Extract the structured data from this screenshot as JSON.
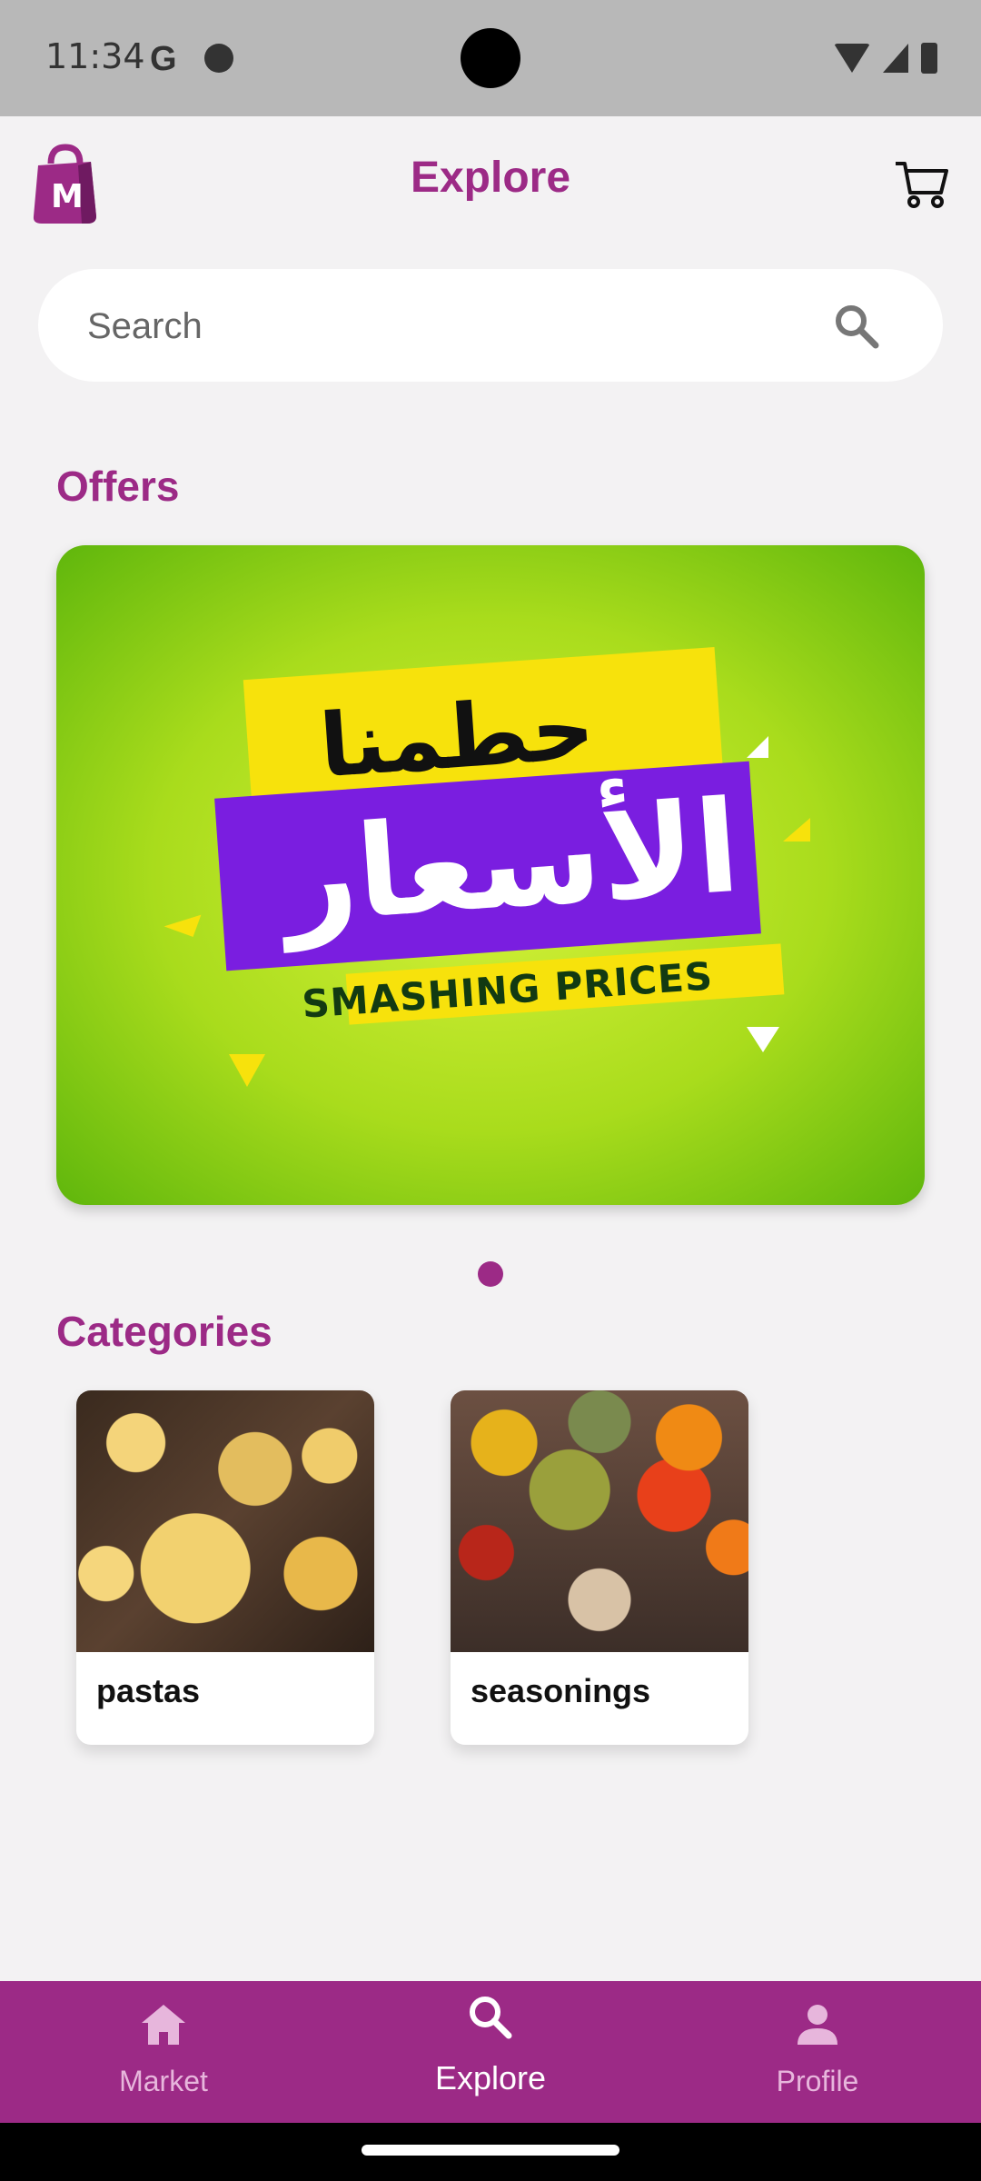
{
  "status_bar": {
    "time": "11:34",
    "g_icon": "G"
  },
  "header": {
    "title": "Explore",
    "logo_letter": "M"
  },
  "search": {
    "placeholder": "Search",
    "value": ""
  },
  "offers": {
    "title": "Offers",
    "banner": {
      "arabic_top": "حطمنا",
      "arabic_main": "الأسعار",
      "english": "SMASHING PRICES"
    },
    "page_indicator": {
      "current": 1,
      "total": 1
    }
  },
  "categories": {
    "title": "Categories",
    "items": [
      {
        "label": "pastas",
        "icon": "pasta-image"
      },
      {
        "label": "seasonings",
        "icon": "spices-image"
      }
    ]
  },
  "bottom_nav": {
    "items": [
      {
        "label": "Market",
        "icon": "home-icon",
        "active": false
      },
      {
        "label": "Explore",
        "icon": "search-icon",
        "active": true
      },
      {
        "label": "Profile",
        "icon": "person-icon",
        "active": false
      }
    ]
  },
  "colors": {
    "brand": "#9c2a86",
    "background": "#f3f2f3"
  }
}
